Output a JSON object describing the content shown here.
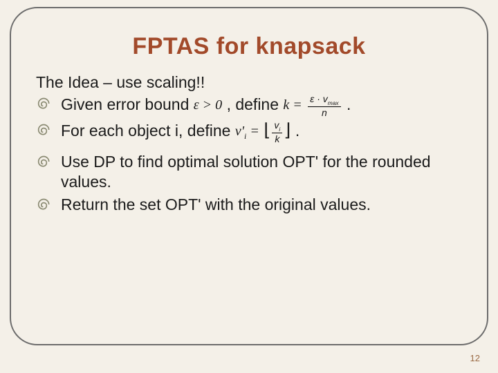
{
  "title": "FPTAS for knapsack",
  "intro": "The Idea – use scaling!!",
  "bullets": {
    "b1": {
      "pre": "Given error bound ",
      "eps": "ε > 0",
      "mid": " ,   define  ",
      "k_eq": "k =",
      "k_num": "ε · v",
      "k_num_sub": "max",
      "k_den": "n",
      "post": "   ."
    },
    "b2": {
      "pre": "For each object i, define  ",
      "vprime": "v'",
      "vsub": "i",
      "eq": " =",
      "num": "v",
      "numsub": "i",
      "den": "k",
      "post": "   ."
    },
    "b3": "Use DP to find optimal solution OPT' for the rounded values.",
    "b4": "Return the set OPT' with the original values."
  },
  "page_number": "12"
}
